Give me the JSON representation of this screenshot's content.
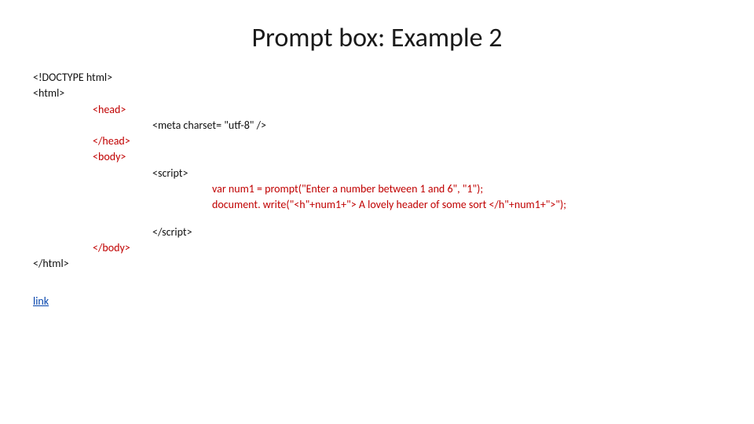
{
  "title": "Prompt box: Example 2",
  "code": {
    "l1": "<!DOCTYPE html>",
    "l2": "<html>",
    "l3": "<head>",
    "l4": "<meta charset= \"utf-8\" />",
    "l5": "</head>",
    "l6": "<body>",
    "l7": "<script>",
    "l8": "var num1 = prompt(\"Enter a number between 1 and 6\", \"1\");",
    "l9": "document. write(\"<h\"+num1+\"> A lovely header of some sort </h\"+num1+\">\");",
    "l10": "</script>",
    "l11": "</body>",
    "l12": "</html>"
  },
  "link_text": "link"
}
